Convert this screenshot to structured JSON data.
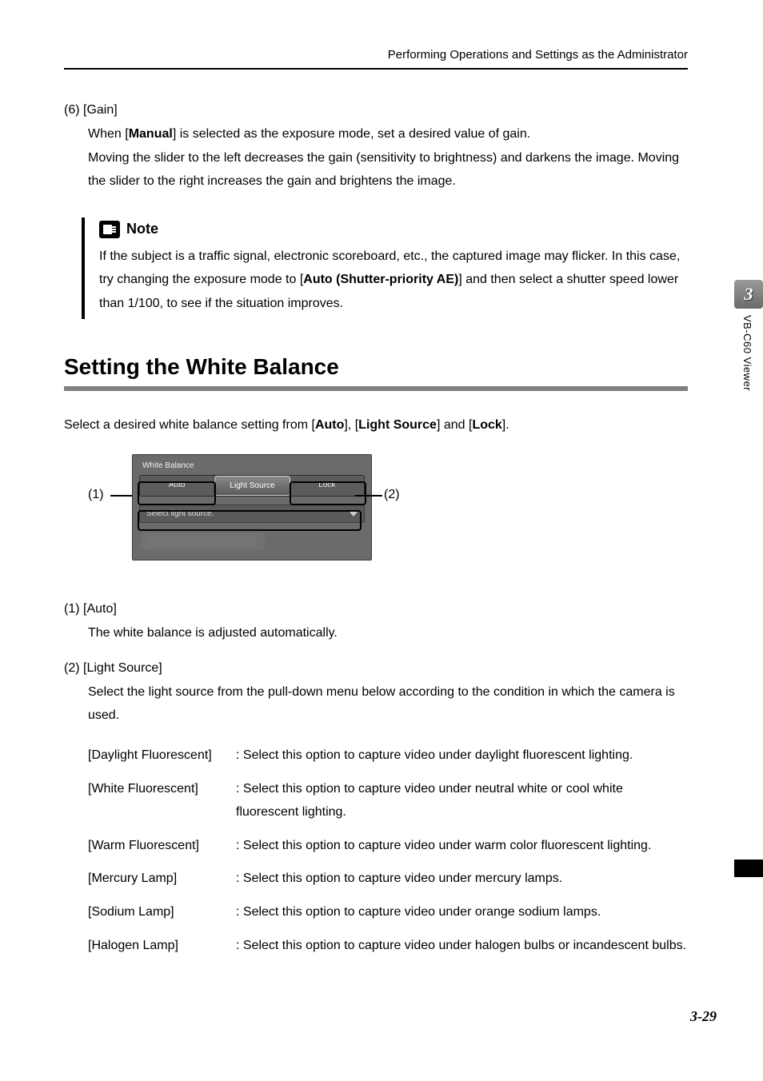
{
  "header": {
    "running_title": "Performing Operations and Settings as the Administrator"
  },
  "section6": {
    "num": "(6)",
    "title": "[Gain]",
    "body_prefix": "When [",
    "body_bold": "Manual",
    "body_suffix": "] is selected as the exposure mode, set a desired value of gain.",
    "body2": "Moving the slider to the left decreases the gain (sensitivity to brightness) and darkens the image. Moving the slider to the right increases the gain and brightens the image."
  },
  "note": {
    "label": "Note",
    "p1_a": "If the subject is a traffic signal, electronic scoreboard, etc., the captured image may flicker.",
    "p1_b_prefix": "In this case, try changing the exposure mode to [",
    "p1_b_bold": "Auto (Shutter-priority AE)",
    "p1_b_suffix": "] and then select a shutter speed lower than 1/100, to see if the situation improves."
  },
  "h2": "Setting the White Balance",
  "intro": {
    "prefix": "Select a desired white balance setting from [",
    "b1": "Auto",
    "mid1": "], [",
    "b2": "Light Source",
    "mid2": "] and [",
    "b3": "Lock",
    "suffix": "]."
  },
  "ui": {
    "callout_left": "(1)",
    "callout_right": "(2)",
    "panel_title": "White Balance",
    "tabs": {
      "auto": "Auto",
      "light": "Light Source",
      "lock": "Lock"
    },
    "dropdown_text": "Select light source."
  },
  "def1": {
    "num": "(1)",
    "title": "[Auto]",
    "body": "The white balance is adjusted automatically."
  },
  "def2": {
    "num": "(2)",
    "title": "[Light Source]",
    "body": "Select the light source from the pull-down menu below according to the condition in which the camera is used."
  },
  "light_sources": [
    {
      "key": "[Daylight Fluorescent]",
      "val": ": Select this option to capture video under daylight fluorescent lighting."
    },
    {
      "key": "[White Fluorescent]",
      "val": ": Select this option to capture video under neutral white or cool white fluorescent lighting."
    },
    {
      "key": "[Warm Fluorescent]",
      "val": ": Select this option to capture video under warm color fluorescent lighting."
    },
    {
      "key": "[Mercury Lamp]",
      "val": ": Select this option to capture video under mercury lamps."
    },
    {
      "key": "[Sodium Lamp]",
      "val": ": Select this option to capture video under orange sodium lamps."
    },
    {
      "key": "[Halogen Lamp]",
      "val": ": Select this option to capture video under halogen bulbs or incandescent bulbs."
    }
  ],
  "sidebar": {
    "chapter_num": "3",
    "chapter_label": "VB-C60 Viewer"
  },
  "page_num": "3-29"
}
